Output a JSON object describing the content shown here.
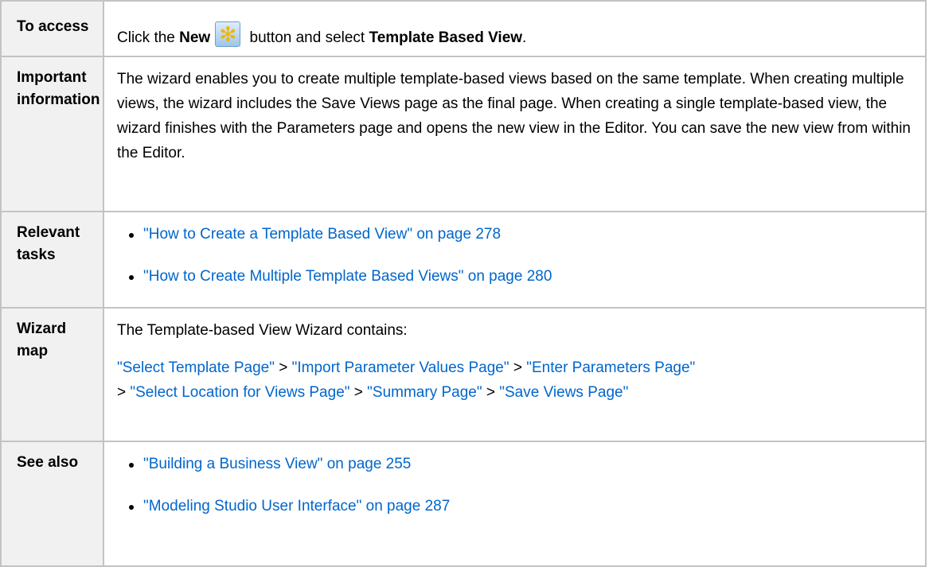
{
  "colors": {
    "link": "#0066cc",
    "label_background": "#f1f1f1",
    "border": "#c3c3c3",
    "icon_star": "#f2b400"
  },
  "access": {
    "label": "To access",
    "text_before": "Click the ",
    "new_label": "New",
    "new_icon": "new-star-icon",
    "text_middle": " button and select ",
    "template_based_view": "Template Based View",
    "text_end": "."
  },
  "important": {
    "label_line1": "Important",
    "label_line2": "information",
    "text": "The wizard enables you to create multiple template-based views based on the same template. When creating multiple views, the wizard includes the Save Views page as the final page. When creating a single template-based view, the wizard finishes with the Parameters page and opens the new view in the Editor. You can save the new view from within the Editor."
  },
  "tasks": {
    "label_line1": "Relevant",
    "label_line2": "tasks",
    "items": [
      "\"How to Create a Template Based View\" on page 278",
      "\"How to Create Multiple Template Based Views\" on page 280"
    ]
  },
  "wizard_map": {
    "label": "Wizard map",
    "intro": "The Template-based View Wizard contains:",
    "separator": " > ",
    "steps": [
      "\"Select Template Page\"",
      "\"Import Parameter Values Page\"",
      "\"Enter Parameters Page\"",
      "\"Select Location for Views Page\"",
      "\"Summary Page\"",
      "\"Save Views Page\""
    ]
  },
  "see_also": {
    "label": "See also",
    "items": [
      "\"Building a Business View\" on page 255",
      "\"Modeling Studio User Interface\" on page 287"
    ]
  }
}
